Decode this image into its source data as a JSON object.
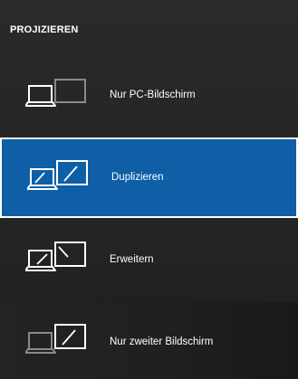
{
  "header": {
    "title": "PROJIZIEREN"
  },
  "options": [
    {
      "label": "Nur PC-Bildschirm",
      "icon": "pc-screen-only-icon",
      "selected": false
    },
    {
      "label": "Duplizieren",
      "icon": "duplicate-icon",
      "selected": true
    },
    {
      "label": "Erweitern",
      "icon": "extend-icon",
      "selected": false
    },
    {
      "label": "Nur zweiter Bildschirm",
      "icon": "second-screen-only-icon",
      "selected": false
    }
  ],
  "colors": {
    "background": "#262626",
    "selected_fill": "#0e5fa6",
    "selected_border": "#ffffff",
    "text": "#ffffff",
    "inactive_icon": "#8a8a8a"
  }
}
